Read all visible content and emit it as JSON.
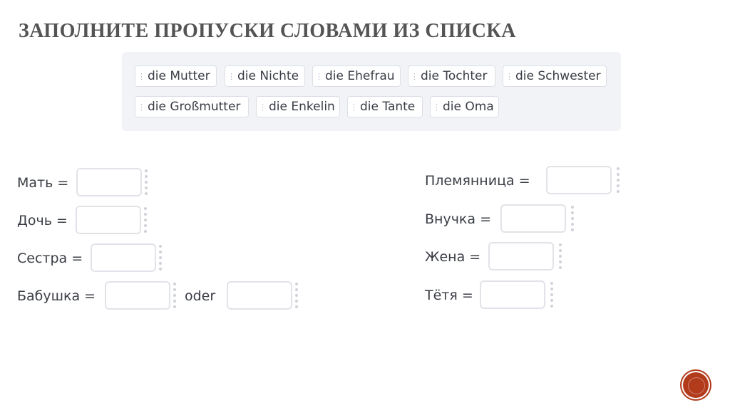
{
  "title": "ЗАПОЛНИТЕ ПРОПУСКИ СЛОВАМИ ИЗ СПИСКА",
  "word_bank": [
    "die Mutter",
    "die Nichte",
    "die Ehefrau",
    "die Tochter",
    "die Schwester",
    "die Großmutter",
    "die Enkelin",
    "die Tante",
    "die Oma"
  ],
  "left_items": [
    "Мать =",
    "Дочь =",
    "Сестра =",
    "Бабушка ="
  ],
  "left_connector": "oder",
  "right_items": [
    "Племянница =",
    "Внучка =",
    "Жена =",
    "Тётя ="
  ],
  "grip_icon": "drag-handle-icon",
  "colors": {
    "title": "#545454",
    "bank_background": "#f1f3f6",
    "text": "#3a3d45",
    "drop_border": "#e1e3e8",
    "logo": "#b23b1c"
  }
}
